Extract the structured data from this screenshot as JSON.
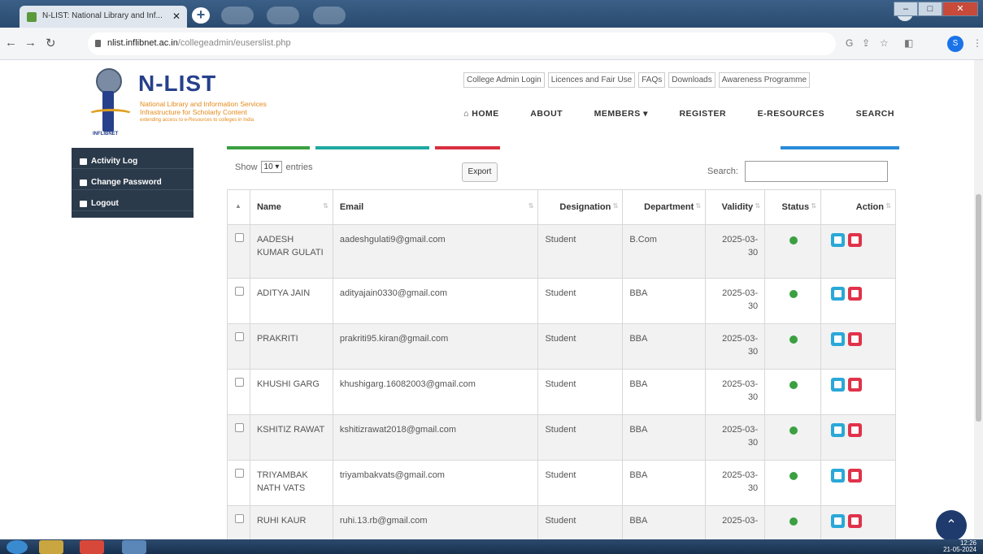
{
  "browser": {
    "tab_title": "N-LIST: National Library and Inf...",
    "url_host": "nlist.inflibnet.ac.in",
    "url_path": "/collegeadmin/euserslist.php",
    "profile_letter": "S"
  },
  "site": {
    "brand": "N-LIST",
    "subtitle_line1": "National Library and Information Services",
    "subtitle_line2": "Infrastructure for Scholarly Content",
    "tagline": "extending access to e-Resources to colleges in India",
    "logo_text": "INFLIBNET",
    "top_links": [
      "College Admin Login",
      "Licences and Fair Use",
      "FAQs",
      "Downloads",
      "Awareness Programme"
    ],
    "main_nav": [
      "HOME",
      "ABOUT",
      "MEMBERS",
      "REGISTER",
      "E-RESOURCES",
      "SEARCH"
    ]
  },
  "sidebar": {
    "items": [
      {
        "label": "Activity Log"
      },
      {
        "label": "Change Password"
      },
      {
        "label": "Logout"
      }
    ]
  },
  "table_controls": {
    "show_label": "Show",
    "entries_value": "10",
    "entries_label": "entries",
    "export_label": "Export",
    "search_label": "Search:"
  },
  "table": {
    "headers": [
      "Name",
      "Email",
      "Designation",
      "Department",
      "Validity",
      "Status",
      "Action"
    ],
    "rows": [
      {
        "name": "AADESH KUMAR GULATI",
        "email": "aadeshgulati9@gmail.com",
        "designation": "Student",
        "department": "B.Com",
        "validity": "2025-03-30"
      },
      {
        "name": "ADITYA JAIN",
        "email": "adityajain0330@gmail.com",
        "designation": "Student",
        "department": "BBA",
        "validity": "2025-03-30"
      },
      {
        "name": "PRAKRITI",
        "email": "prakriti95.kiran@gmail.com",
        "designation": "Student",
        "department": "BBA",
        "validity": "2025-03-30"
      },
      {
        "name": "KHUSHI GARG",
        "email": "khushigarg.16082003@gmail.com",
        "designation": "Student",
        "department": "BBA",
        "validity": "2025-03-30"
      },
      {
        "name": "KSHITIZ RAWAT",
        "email": "kshitizrawat2018@gmail.com",
        "designation": "Student",
        "department": "BBA",
        "validity": "2025-03-30"
      },
      {
        "name": "TRIYAMBAK NATH VATS",
        "email": "triyambakvats@gmail.com",
        "designation": "Student",
        "department": "BBA",
        "validity": "2025-03-30"
      },
      {
        "name": "RUHI KAUR",
        "email": "ruhi.13.rb@gmail.com",
        "designation": "Student",
        "department": "BBA",
        "validity": "2025-03-"
      }
    ]
  },
  "taskbar": {
    "time": "12:26",
    "date": "21-05-2024"
  },
  "colors": {
    "brand_blue": "#27408b",
    "status_active": "#3aa040",
    "edit_button": "#2aa8d8",
    "delete_button": "#e0334a"
  }
}
